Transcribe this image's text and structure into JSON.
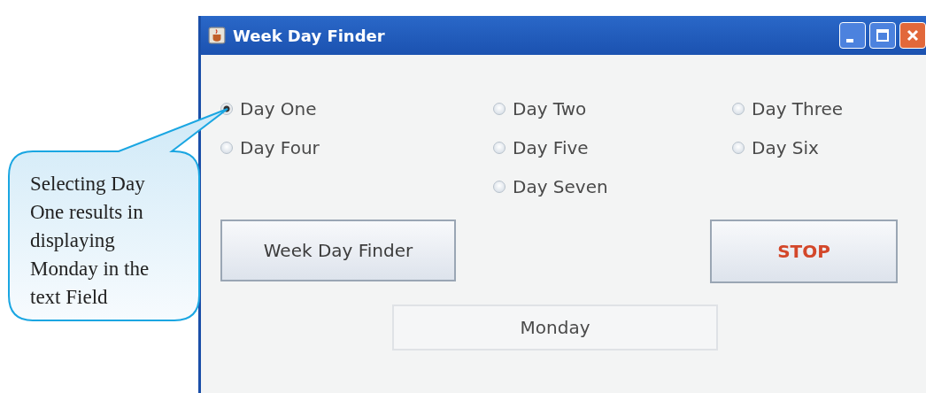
{
  "window": {
    "title": "Week Day Finder"
  },
  "radios": [
    {
      "label": "Day One",
      "selected": true
    },
    {
      "label": "Day Two",
      "selected": false
    },
    {
      "label": "Day Three",
      "selected": false
    },
    {
      "label": "Day Four",
      "selected": false
    },
    {
      "label": "Day Five",
      "selected": false
    },
    {
      "label": "Day Six",
      "selected": false
    },
    {
      "label": "Day Seven",
      "selected": false
    }
  ],
  "buttons": [
    {
      "label": "Week Day Finder",
      "kind": "default"
    },
    {
      "label": "STOP",
      "kind": "danger"
    }
  ],
  "text_field": {
    "value": "Monday"
  },
  "callout": {
    "text": "Selecting Day One results in displaying Monday in the text Field"
  }
}
